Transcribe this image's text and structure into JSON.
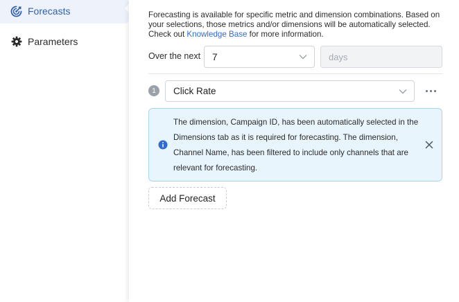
{
  "sidebar": {
    "items": [
      {
        "label": "Forecasts",
        "icon": "forecast-icon",
        "active": true
      },
      {
        "label": "Parameters",
        "icon": "gear-icon",
        "active": false
      }
    ]
  },
  "intro": {
    "text_before_link": "Forecasting is available for specific metric and dimension combinations. Based on your selections, those metrics and/or dimensions will be automatically selected. Check out ",
    "link_text": "Knowledge Base",
    "text_after_link": " for more information."
  },
  "horizon": {
    "label": "Over the next",
    "value": "7",
    "unit_placeholder": "days"
  },
  "forecast_rows": [
    {
      "index": "1",
      "metric": "Click Rate"
    }
  ],
  "alert": {
    "message": "The dimension, Campaign ID, has been automatically selected in the Dimensions tab as it is required for forecasting. The dimension, Channel Name, has been filtered to include only channels that are relevant for forecasting."
  },
  "actions": {
    "add_forecast_label": "Add Forecast"
  },
  "colors": {
    "accent": "#2f5fb3",
    "link": "#2f6bd0",
    "info_bg": "#e9f5fd",
    "info_border": "#a9d4ee",
    "info_icon": "#2f6bd0"
  }
}
